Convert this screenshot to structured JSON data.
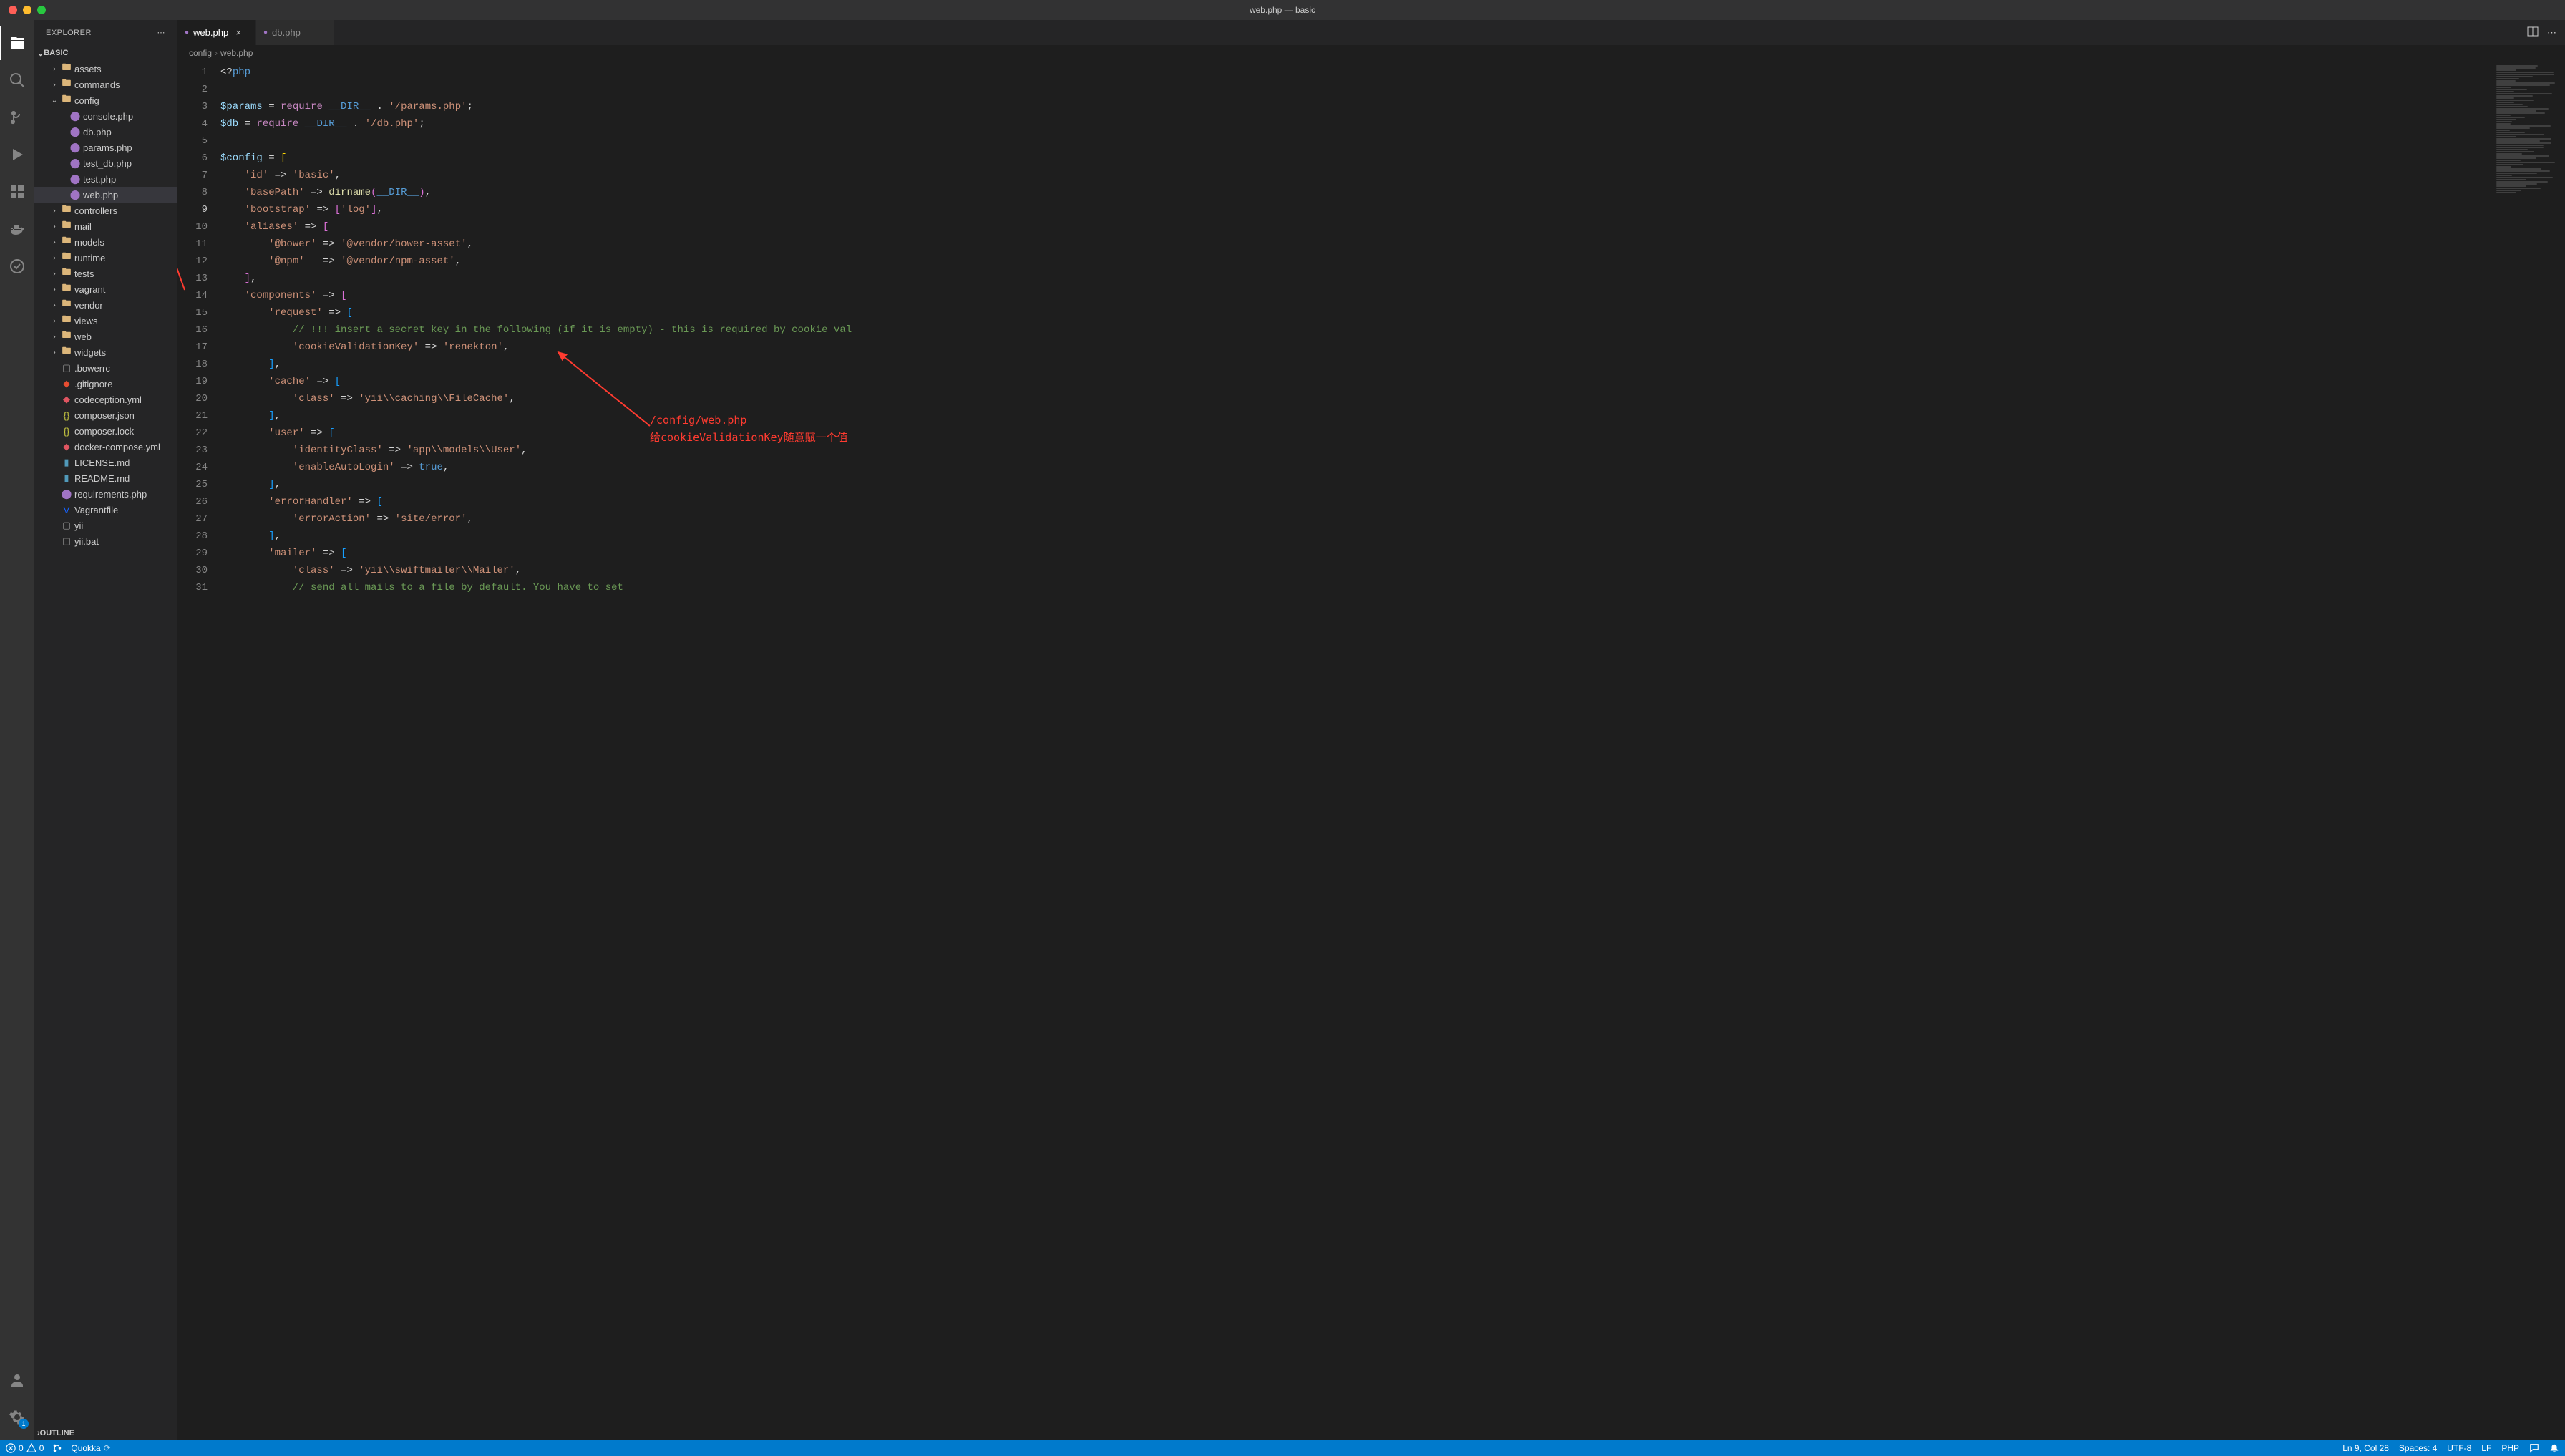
{
  "window": {
    "title": "web.php — basic"
  },
  "explorer": {
    "title": "EXPLORER",
    "project": "BASIC",
    "outline": "OUTLINE",
    "tree": [
      {
        "type": "folder",
        "name": "assets",
        "depth": 1,
        "open": false
      },
      {
        "type": "folder",
        "name": "commands",
        "depth": 1,
        "open": false
      },
      {
        "type": "folder",
        "name": "config",
        "depth": 1,
        "open": true
      },
      {
        "type": "file",
        "name": "console.php",
        "depth": 2,
        "icon": "php"
      },
      {
        "type": "file",
        "name": "db.php",
        "depth": 2,
        "icon": "php"
      },
      {
        "type": "file",
        "name": "params.php",
        "depth": 2,
        "icon": "php"
      },
      {
        "type": "file",
        "name": "test_db.php",
        "depth": 2,
        "icon": "php"
      },
      {
        "type": "file",
        "name": "test.php",
        "depth": 2,
        "icon": "php"
      },
      {
        "type": "file",
        "name": "web.php",
        "depth": 2,
        "icon": "php",
        "selected": true
      },
      {
        "type": "folder",
        "name": "controllers",
        "depth": 1,
        "open": false,
        "icon": "ctrl"
      },
      {
        "type": "folder",
        "name": "mail",
        "depth": 1,
        "open": false
      },
      {
        "type": "folder",
        "name": "models",
        "depth": 1,
        "open": false
      },
      {
        "type": "folder",
        "name": "runtime",
        "depth": 1,
        "open": false
      },
      {
        "type": "folder",
        "name": "tests",
        "depth": 1,
        "open": false
      },
      {
        "type": "folder",
        "name": "vagrant",
        "depth": 1,
        "open": false
      },
      {
        "type": "folder",
        "name": "vendor",
        "depth": 1,
        "open": false
      },
      {
        "type": "folder",
        "name": "views",
        "depth": 1,
        "open": false
      },
      {
        "type": "folder",
        "name": "web",
        "depth": 1,
        "open": false
      },
      {
        "type": "folder",
        "name": "widgets",
        "depth": 1,
        "open": false
      },
      {
        "type": "file",
        "name": ".bowerrc",
        "depth": 1,
        "icon": "generic"
      },
      {
        "type": "file",
        "name": ".gitignore",
        "depth": 1,
        "icon": "git"
      },
      {
        "type": "file",
        "name": "codeception.yml",
        "depth": 1,
        "icon": "yml"
      },
      {
        "type": "file",
        "name": "composer.json",
        "depth": 1,
        "icon": "json"
      },
      {
        "type": "file",
        "name": "composer.lock",
        "depth": 1,
        "icon": "json"
      },
      {
        "type": "file",
        "name": "docker-compose.yml",
        "depth": 1,
        "icon": "yml"
      },
      {
        "type": "file",
        "name": "LICENSE.md",
        "depth": 1,
        "icon": "md"
      },
      {
        "type": "file",
        "name": "README.md",
        "depth": 1,
        "icon": "md"
      },
      {
        "type": "file",
        "name": "requirements.php",
        "depth": 1,
        "icon": "php"
      },
      {
        "type": "file",
        "name": "Vagrantfile",
        "depth": 1,
        "icon": "vagrant"
      },
      {
        "type": "file",
        "name": "yii",
        "depth": 1,
        "icon": "generic"
      },
      {
        "type": "file",
        "name": "yii.bat",
        "depth": 1,
        "icon": "generic"
      }
    ]
  },
  "tabs": [
    {
      "label": "web.php",
      "active": true,
      "icon": "php"
    },
    {
      "label": "db.php",
      "active": false,
      "icon": "php"
    }
  ],
  "tabActions": {
    "split": "⫿",
    "more": "⋯"
  },
  "breadcrumbs": [
    "config",
    "web.php"
  ],
  "code": {
    "lines": [
      {
        "n": 1,
        "html": "<span class='tok-punct'>&lt;?</span><span class='tok-tag'>php</span>"
      },
      {
        "n": 2,
        "html": ""
      },
      {
        "n": 3,
        "html": "<span class='tok-var'>$params</span> <span class='tok-punct'>=</span> <span class='tok-kw'>require</span> <span class='tok-const'>__DIR__</span> <span class='tok-punct'>.</span> <span class='tok-str'>'/params.php'</span><span class='tok-punct'>;</span>"
      },
      {
        "n": 4,
        "html": "<span class='tok-var'>$db</span> <span class='tok-punct'>=</span> <span class='tok-kw'>require</span> <span class='tok-const'>__DIR__</span> <span class='tok-punct'>.</span> <span class='tok-str'>'/db.php'</span><span class='tok-punct'>;</span>"
      },
      {
        "n": 5,
        "html": ""
      },
      {
        "n": 6,
        "html": "<span class='tok-var'>$config</span> <span class='tok-punct'>=</span> <span class='bracket-y'>[</span>"
      },
      {
        "n": 7,
        "html": "    <span class='tok-str'>'id'</span> <span class='tok-punct'>=&gt;</span> <span class='tok-str'>'basic'</span><span class='tok-punct'>,</span>"
      },
      {
        "n": 8,
        "html": "    <span class='tok-str'>'basePath'</span> <span class='tok-punct'>=&gt;</span> <span class='tok-func'>dirname</span><span class='bracket-p'>(</span><span class='tok-const'>__DIR__</span><span class='bracket-p'>)</span><span class='tok-punct'>,</span>"
      },
      {
        "n": 9,
        "html": "    <span class='tok-str'>'bootstrap'</span> <span class='tok-punct'>=&gt;</span> <span class='bracket-p'>[</span><span class='tok-str'>'log'</span><span class='bracket-p'>]</span><span class='tok-punct'>,</span>",
        "cur": true
      },
      {
        "n": 10,
        "html": "    <span class='tok-str'>'aliases'</span> <span class='tok-punct'>=&gt;</span> <span class='bracket-p'>[</span>"
      },
      {
        "n": 11,
        "html": "        <span class='tok-str'>'@bower'</span> <span class='tok-punct'>=&gt;</span> <span class='tok-str'>'@vendor/bower-asset'</span><span class='tok-punct'>,</span>"
      },
      {
        "n": 12,
        "html": "        <span class='tok-str'>'@npm'</span>   <span class='tok-punct'>=&gt;</span> <span class='tok-str'>'@vendor/npm-asset'</span><span class='tok-punct'>,</span>"
      },
      {
        "n": 13,
        "html": "    <span class='bracket-p'>]</span><span class='tok-punct'>,</span>"
      },
      {
        "n": 14,
        "html": "    <span class='tok-str'>'components'</span> <span class='tok-punct'>=&gt;</span> <span class='bracket-p'>[</span>"
      },
      {
        "n": 15,
        "html": "        <span class='tok-str'>'request'</span> <span class='tok-punct'>=&gt;</span> <span class='bracket-b'>[</span>"
      },
      {
        "n": 16,
        "html": "            <span class='tok-comment'>// !!! insert a secret key in the following (if it is empty) - this is required by cookie val</span>"
      },
      {
        "n": 17,
        "html": "            <span class='tok-str'>'cookieValidationKey'</span> <span class='tok-punct'>=&gt;</span> <span class='tok-str'>'renekton'</span><span class='tok-punct'>,</span>"
      },
      {
        "n": 18,
        "html": "        <span class='bracket-b'>]</span><span class='tok-punct'>,</span>"
      },
      {
        "n": 19,
        "html": "        <span class='tok-str'>'cache'</span> <span class='tok-punct'>=&gt;</span> <span class='bracket-b'>[</span>"
      },
      {
        "n": 20,
        "html": "            <span class='tok-str'>'class'</span> <span class='tok-punct'>=&gt;</span> <span class='tok-str'>'yii\\\\caching\\\\FileCache'</span><span class='tok-punct'>,</span>"
      },
      {
        "n": 21,
        "html": "        <span class='bracket-b'>]</span><span class='tok-punct'>,</span>"
      },
      {
        "n": 22,
        "html": "        <span class='tok-str'>'user'</span> <span class='tok-punct'>=&gt;</span> <span class='bracket-b'>[</span>"
      },
      {
        "n": 23,
        "html": "            <span class='tok-str'>'identityClass'</span> <span class='tok-punct'>=&gt;</span> <span class='tok-str'>'app\\\\models\\\\User'</span><span class='tok-punct'>,</span>"
      },
      {
        "n": 24,
        "html": "            <span class='tok-str'>'enableAutoLogin'</span> <span class='tok-punct'>=&gt;</span> <span class='tok-bool'>true</span><span class='tok-punct'>,</span>"
      },
      {
        "n": 25,
        "html": "        <span class='bracket-b'>]</span><span class='tok-punct'>,</span>"
      },
      {
        "n": 26,
        "html": "        <span class='tok-str'>'errorHandler'</span> <span class='tok-punct'>=&gt;</span> <span class='bracket-b'>[</span>"
      },
      {
        "n": 27,
        "html": "            <span class='tok-str'>'errorAction'</span> <span class='tok-punct'>=&gt;</span> <span class='tok-str'>'site/error'</span><span class='tok-punct'>,</span>"
      },
      {
        "n": 28,
        "html": "        <span class='bracket-b'>]</span><span class='tok-punct'>,</span>"
      },
      {
        "n": 29,
        "html": "        <span class='tok-str'>'mailer'</span> <span class='tok-punct'>=&gt;</span> <span class='bracket-b'>[</span>"
      },
      {
        "n": 30,
        "html": "            <span class='tok-str'>'class'</span> <span class='tok-punct'>=&gt;</span> <span class='tok-str'>'yii\\\\swiftmailer\\\\Mailer'</span><span class='tok-punct'>,</span>"
      },
      {
        "n": 31,
        "html": "            <span class='tok-comment'>// send all mails to a file by default. You have to set</span>"
      }
    ]
  },
  "annotations": {
    "line1": "/config/web.php",
    "line2": "给cookieValidationKey随意赋一个值"
  },
  "status": {
    "errors": "0",
    "warnings": "0",
    "quokka": "Quokka",
    "lncol": "Ln 9, Col 28",
    "spaces": "Spaces: 4",
    "encoding": "UTF-8",
    "eol": "LF",
    "lang": "PHP"
  },
  "settingsBadge": "1"
}
